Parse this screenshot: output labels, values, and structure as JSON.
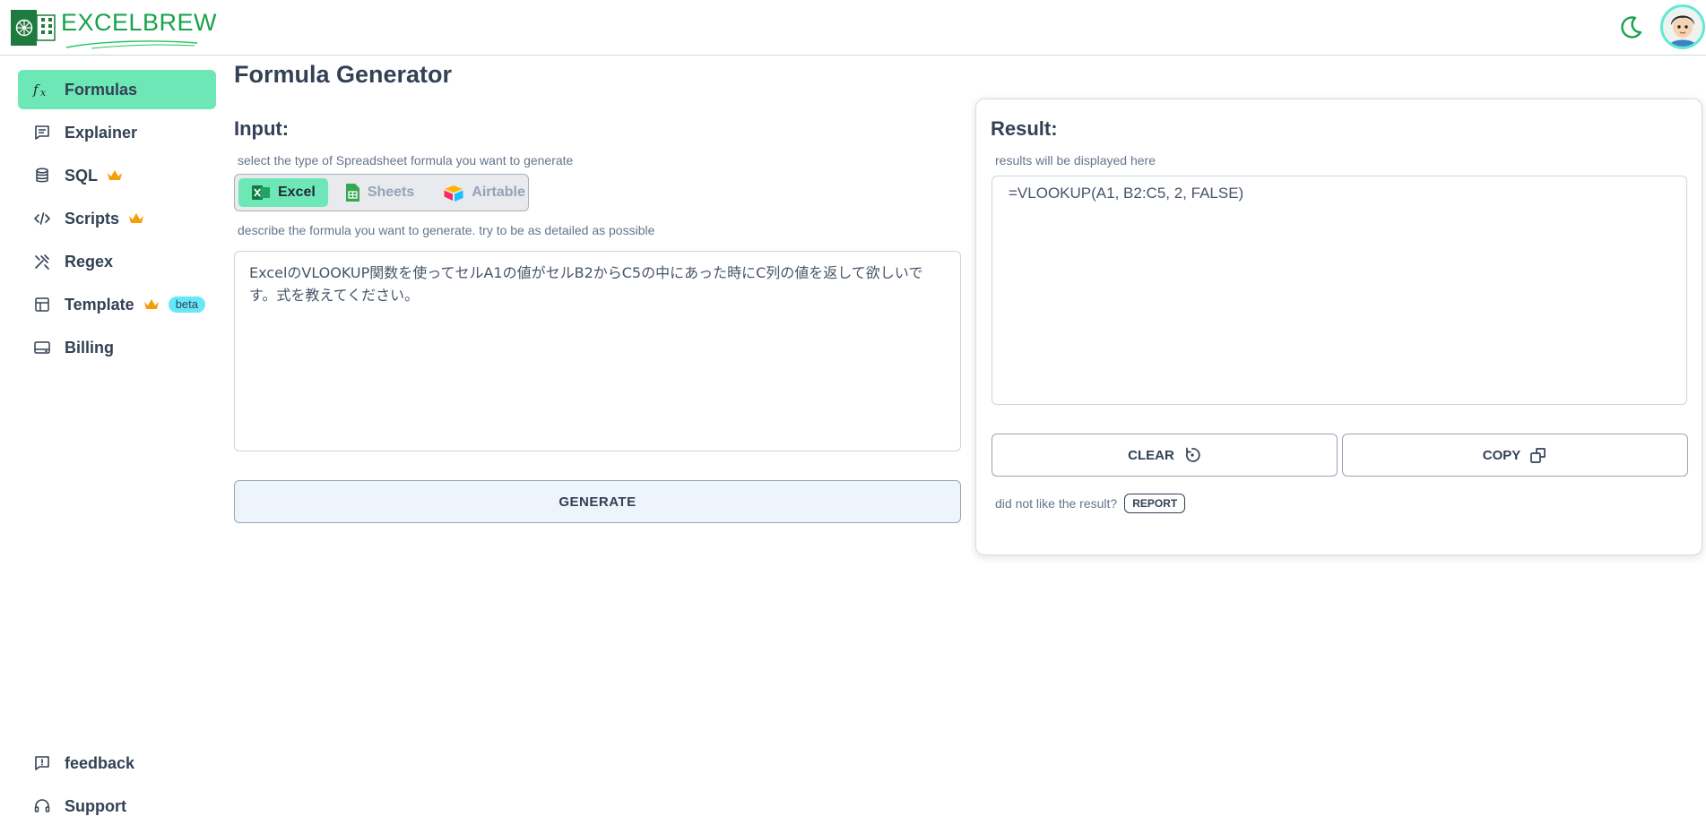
{
  "app": {
    "brand": "EXCELBREW"
  },
  "colors": {
    "accent": "#6ee7b7",
    "brand_green": "#16a34a",
    "crown": "#f59e0b",
    "beta_badge": "#67e8f9"
  },
  "sidebar": {
    "items": [
      {
        "label": "Formulas",
        "icon": "function-icon",
        "active": true
      },
      {
        "label": "Explainer",
        "icon": "message-lines-icon"
      },
      {
        "label": "SQL",
        "icon": "database-icon",
        "premium": true
      },
      {
        "label": "Scripts",
        "icon": "code-icon",
        "premium": true
      },
      {
        "label": "Regex",
        "icon": "regex-tools-icon"
      },
      {
        "label": "Template",
        "icon": "table-grid-icon",
        "premium": true,
        "badge": "beta"
      },
      {
        "label": "Billing",
        "icon": "card-icon"
      }
    ],
    "bottom": [
      {
        "label": "feedback",
        "icon": "feedback-icon"
      },
      {
        "label": "Support",
        "icon": "headset-icon"
      }
    ]
  },
  "main": {
    "title": "Formula Generator",
    "input": {
      "heading": "Input:",
      "type_hint": "select the type of Spreadsheet formula you want to generate",
      "types": [
        {
          "label": "Excel",
          "icon": "excel-icon",
          "selected": true
        },
        {
          "label": "Sheets",
          "icon": "sheets-icon"
        },
        {
          "label": "Airtable",
          "icon": "airtable-icon"
        }
      ],
      "describe_hint": "describe the formula you want to generate. try to be as detailed as possible",
      "prompt": "ExcelのVLOOKUP関数を使ってセルA1の値がセルB2からC5の中にあった時にC列の値を返して欲しいです。式を教えてください。",
      "generate_label": "GENERATE"
    },
    "result": {
      "heading": "Result:",
      "hint": "results will be displayed here",
      "value": "=VLOOKUP(A1, B2:C5, 2, FALSE)",
      "clear_label": "CLEAR",
      "copy_label": "COPY",
      "report_prompt": "did not like the result?",
      "report_label": "REPORT"
    }
  }
}
